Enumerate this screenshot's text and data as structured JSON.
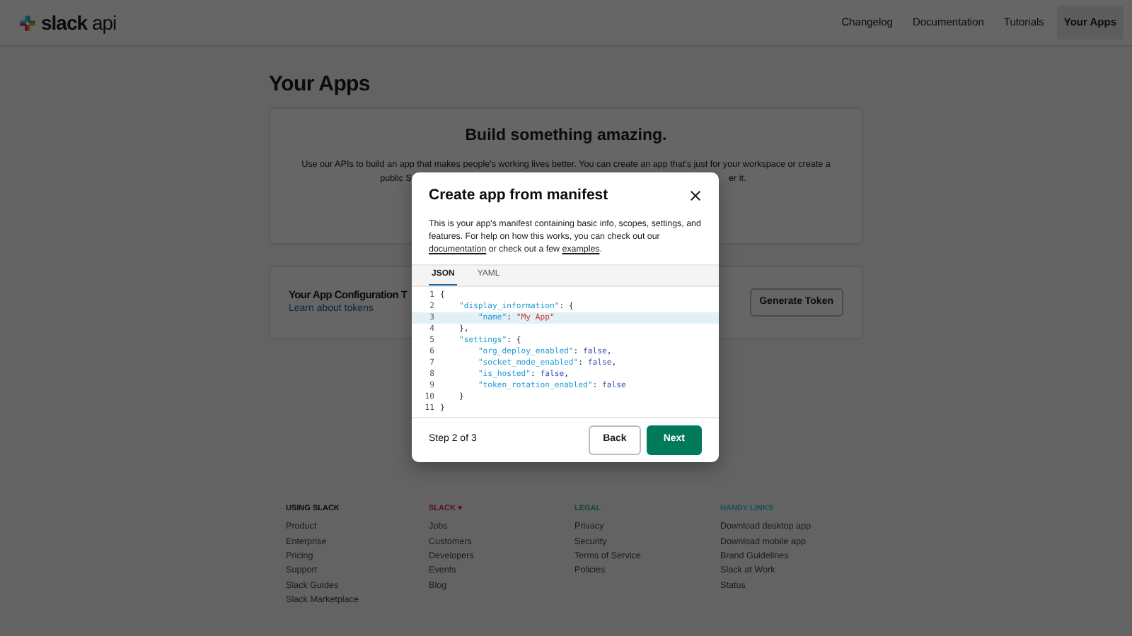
{
  "header": {
    "logo": {
      "brand": "slack",
      "suffix": "api"
    },
    "nav": [
      {
        "label": "Changelog",
        "selected": false
      },
      {
        "label": "Documentation",
        "selected": false
      },
      {
        "label": "Tutorials",
        "selected": false
      },
      {
        "label": "Your Apps",
        "selected": true
      }
    ]
  },
  "page_title": "Your Apps",
  "intro_card": {
    "heading": "Build something amazing.",
    "line_1": "Use our APIs to build an app that makes people's working lives better. You can create an app that's just for your workspace or create a",
    "line_2_left": "public S",
    "line_2_right": "er it."
  },
  "tokens_card": {
    "title": "Your App Configuration T",
    "link": "Learn about tokens",
    "button": "Generate Token"
  },
  "footer": {
    "columns": [
      {
        "heading": "USING SLACK",
        "color": "#0c0b0c",
        "links": [
          "Product",
          "Enterprise",
          "Pricing",
          "Support",
          "Slack Guides",
          "Slack Marketplace"
        ]
      },
      {
        "heading": "SLACK ♥",
        "color": "#5a0c24",
        "links": [
          "Jobs",
          "Customers",
          "Developers",
          "Events",
          "Blog"
        ]
      },
      {
        "heading": "LEGAL",
        "color": "#124932",
        "links": [
          "Privacy",
          "Security",
          "Terms of Service",
          "Policies"
        ]
      },
      {
        "heading": "HANDY LINKS",
        "color": "#164f60",
        "links": [
          "Download desktop app",
          "Download mobile app",
          "Brand Guidelines",
          "Slack at Work",
          "Status"
        ]
      }
    ]
  },
  "modal": {
    "title": "Create app from manifest",
    "description": "This is your app's manifest containing basic info, scopes, settings, and features. For help on how this works, you can check out our ",
    "link_1": "documentation",
    "middle": " or check out a few ",
    "link_2": "examples",
    "end": ".",
    "tabs": [
      {
        "label": "JSON",
        "selected": true
      },
      {
        "label": "YAML",
        "selected": false
      }
    ],
    "code_lines": [
      {
        "number": "1",
        "highlighted": false,
        "tokens": [
          {
            "kind": "punct",
            "text": "{"
          }
        ]
      },
      {
        "number": "2",
        "highlighted": false,
        "tokens": [
          {
            "kind": "key",
            "text": "    \"display_information\""
          },
          {
            "kind": "punct",
            "text": ": {"
          }
        ]
      },
      {
        "number": "3",
        "highlighted": true,
        "tokens": [
          {
            "kind": "key",
            "text": "        \"name\""
          },
          {
            "kind": "punct",
            "text": ": "
          },
          {
            "kind": "string",
            "text": "\"My App\""
          }
        ]
      },
      {
        "number": "4",
        "highlighted": false,
        "tokens": [
          {
            "kind": "punct",
            "text": "    },"
          }
        ]
      },
      {
        "number": "5",
        "highlighted": false,
        "tokens": [
          {
            "kind": "key",
            "text": "    \"settings\""
          },
          {
            "kind": "punct",
            "text": ": {"
          }
        ]
      },
      {
        "number": "6",
        "highlighted": false,
        "tokens": [
          {
            "kind": "key",
            "text": "        \"org_deploy_enabled\""
          },
          {
            "kind": "punct",
            "text": ": "
          },
          {
            "kind": "literal",
            "text": "false"
          },
          {
            "kind": "punct",
            "text": ","
          }
        ]
      },
      {
        "number": "7",
        "highlighted": false,
        "tokens": [
          {
            "kind": "key",
            "text": "        \"socket_mode_enabled\""
          },
          {
            "kind": "punct",
            "text": ": "
          },
          {
            "kind": "literal",
            "text": "false"
          },
          {
            "kind": "punct",
            "text": ","
          }
        ]
      },
      {
        "number": "8",
        "highlighted": false,
        "tokens": [
          {
            "kind": "key",
            "text": "        \"is_hosted\""
          },
          {
            "kind": "punct",
            "text": ": "
          },
          {
            "kind": "literal",
            "text": "false"
          },
          {
            "kind": "punct",
            "text": ","
          }
        ]
      },
      {
        "number": "9",
        "highlighted": false,
        "tokens": [
          {
            "kind": "key",
            "text": "        \"token_rotation_enabled\""
          },
          {
            "kind": "punct",
            "text": ": "
          },
          {
            "kind": "literal",
            "text": "false"
          }
        ]
      },
      {
        "number": "10",
        "highlighted": false,
        "tokens": [
          {
            "kind": "punct",
            "text": "    }"
          }
        ]
      },
      {
        "number": "11",
        "highlighted": false,
        "tokens": [
          {
            "kind": "punct",
            "text": "}"
          }
        ]
      }
    ],
    "step": "Step 2 of 3",
    "back_button": "Back",
    "next_button": "Next"
  }
}
